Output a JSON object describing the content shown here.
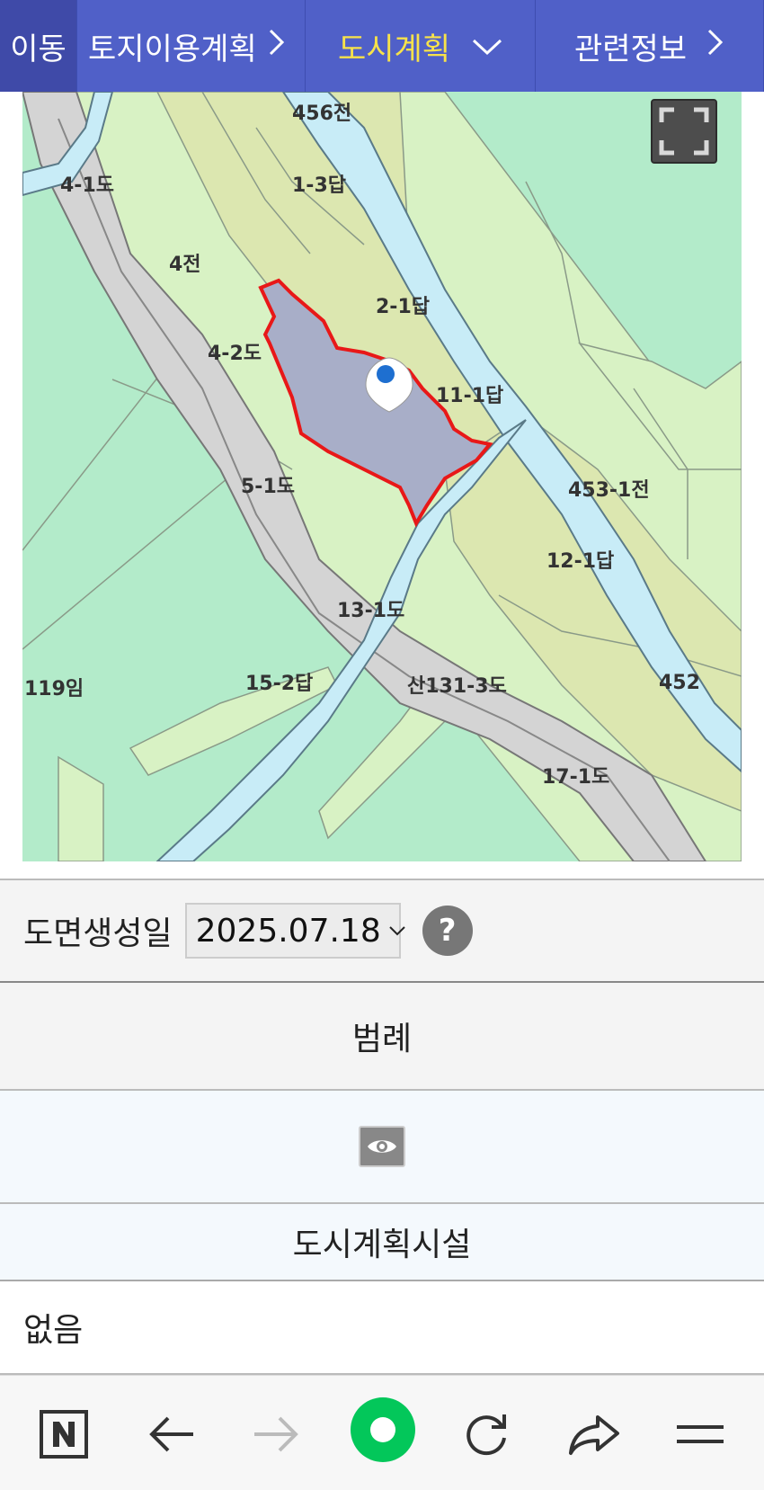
{
  "topnav": {
    "prev_label": "이동",
    "landuse_label": "토지이용계획",
    "urban_label": "도시계획",
    "related_label": "관련정보"
  },
  "map": {
    "parcels": [
      "456전",
      "1-3답",
      "4-1도",
      "4전",
      "2-1답",
      "4-2도",
      "11-1답",
      "5-1도",
      "453-1전",
      "12-1답",
      "13-1도",
      "119임",
      "15-2답",
      "산131-3도",
      "452",
      "17-1도"
    ],
    "colors": {
      "forest": "#b3ebca",
      "field": "#d8f2c4",
      "paddy": "#dce7b0",
      "road": "#d4d4d4",
      "river": "#c8ecf7",
      "selected_fill": "#a8aec8",
      "selected_outline": "#e81818"
    }
  },
  "date": {
    "label": "도면생성일",
    "value": "2025.07.18",
    "help": "?"
  },
  "legend": {
    "title": "범례"
  },
  "section": {
    "title": "도시계획시설",
    "value": "없음"
  },
  "bottom_nav": [
    "naver-home-icon",
    "back-arrow-icon",
    "forward-arrow-icon",
    "green-circle-icon",
    "refresh-icon",
    "share-icon",
    "menu-icon"
  ]
}
